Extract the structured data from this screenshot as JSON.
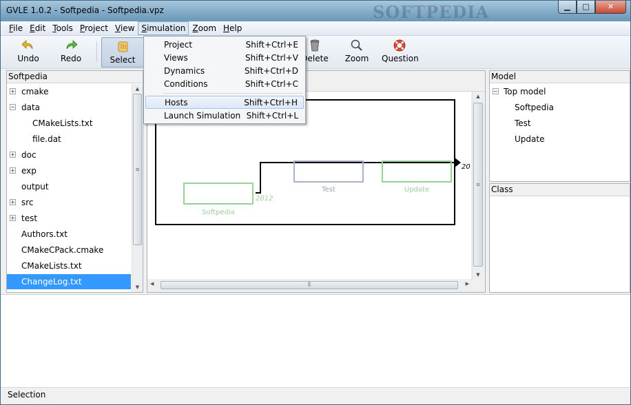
{
  "window": {
    "title": "GVLE 1.0.2 - Softpedia - Softpedia.vpz",
    "watermark": "SOFTPEDIA",
    "controls": {
      "minimize": "▁",
      "maximize": "□",
      "close": "✕"
    }
  },
  "menubar": {
    "items": [
      {
        "label": "File",
        "key": "F",
        "rest": "ile"
      },
      {
        "label": "Edit",
        "key": "E",
        "rest": "dit"
      },
      {
        "label": "Tools",
        "key": "T",
        "rest": "ools"
      },
      {
        "label": "Project",
        "key": "P",
        "rest": "roject"
      },
      {
        "label": "View",
        "key": "V",
        "rest": "iew"
      },
      {
        "label": "Simulation",
        "key": "S",
        "rest": "imulation"
      },
      {
        "label": "Zoom",
        "key": "Z",
        "rest": "oom"
      },
      {
        "label": "Help",
        "key": "H",
        "rest": "elp"
      }
    ]
  },
  "toolbar": {
    "undo": "Undo",
    "redo": "Redo",
    "select": "Select",
    "delete": "Delete",
    "zoom": "Zoom",
    "question": "Question"
  },
  "simulation_menu": {
    "items": [
      {
        "label": "Project",
        "shortcut": "Shift+Ctrl+E"
      },
      {
        "label": "Views",
        "shortcut": "Shift+Ctrl+V"
      },
      {
        "label": "Dynamics",
        "shortcut": "Shift+Ctrl+D"
      },
      {
        "label": "Conditions",
        "shortcut": "Shift+Ctrl+C"
      },
      {
        "label": "Hosts",
        "shortcut": "Shift+Ctrl+H"
      },
      {
        "label": "Launch Simulation",
        "shortcut": "Shift+Ctrl+L"
      }
    ]
  },
  "file_tree": {
    "header": "Softpedia",
    "items": [
      {
        "label": "cmake",
        "expander": "+"
      },
      {
        "label": "data",
        "expander": "−"
      },
      {
        "label": "CMakeLists.txt"
      },
      {
        "label": "file.dat"
      },
      {
        "label": "doc",
        "expander": "+"
      },
      {
        "label": "exp",
        "expander": "+"
      },
      {
        "label": "output"
      },
      {
        "label": "src",
        "expander": "+"
      },
      {
        "label": "test",
        "expander": "+"
      },
      {
        "label": "Authors.txt"
      },
      {
        "label": "CMakeCPack.cmake"
      },
      {
        "label": "CMakeLists.txt"
      },
      {
        "label": "ChangeLog.txt",
        "selected": true
      }
    ]
  },
  "diagram": {
    "models": {
      "softpedia": "Softpedia",
      "test": "Test",
      "update": "Update"
    },
    "port_labels": {
      "p2012": "2012",
      "p20": "20"
    },
    "colors": {
      "softpedia": "#9bd09b",
      "test": "#a9b0cc",
      "update": "#9bd09b",
      "label": "#9aa5b0"
    }
  },
  "model_panel": {
    "header": "Model",
    "root": "Top model",
    "root_expander": "−",
    "children": [
      "Softpedia",
      "Test",
      "Update"
    ]
  },
  "class_panel": {
    "header": "Class"
  },
  "statusbar": {
    "text": "Selection"
  }
}
